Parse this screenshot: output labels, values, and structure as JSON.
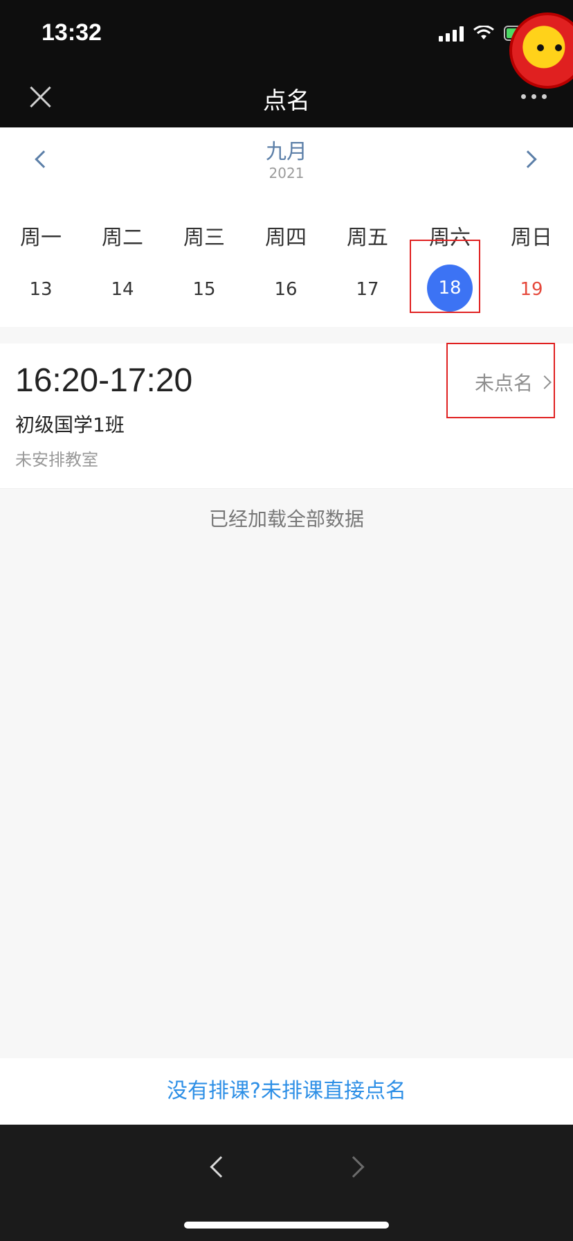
{
  "status_bar": {
    "time": "13:32"
  },
  "nav": {
    "title": "点名"
  },
  "calendar": {
    "month": "九月",
    "year": "2021",
    "days": [
      {
        "weekday": "周一",
        "date": "13"
      },
      {
        "weekday": "周二",
        "date": "14"
      },
      {
        "weekday": "周三",
        "date": "15"
      },
      {
        "weekday": "周四",
        "date": "16"
      },
      {
        "weekday": "周五",
        "date": "17"
      },
      {
        "weekday": "周六",
        "date": "18"
      },
      {
        "weekday": "周日",
        "date": "19"
      }
    ],
    "selected_date": "18"
  },
  "lesson": {
    "time": "16:20-17:20",
    "class_name": "初级国学1班",
    "room": "未安排教室",
    "status": "未点名"
  },
  "list_footer": "已经加载全部数据",
  "bottom_action": "没有排课?未排课直接点名",
  "colors": {
    "accent": "#3c73f4",
    "link": "#2d8fe6",
    "sunday": "#e5493c",
    "highlight_box": "#e02020"
  }
}
